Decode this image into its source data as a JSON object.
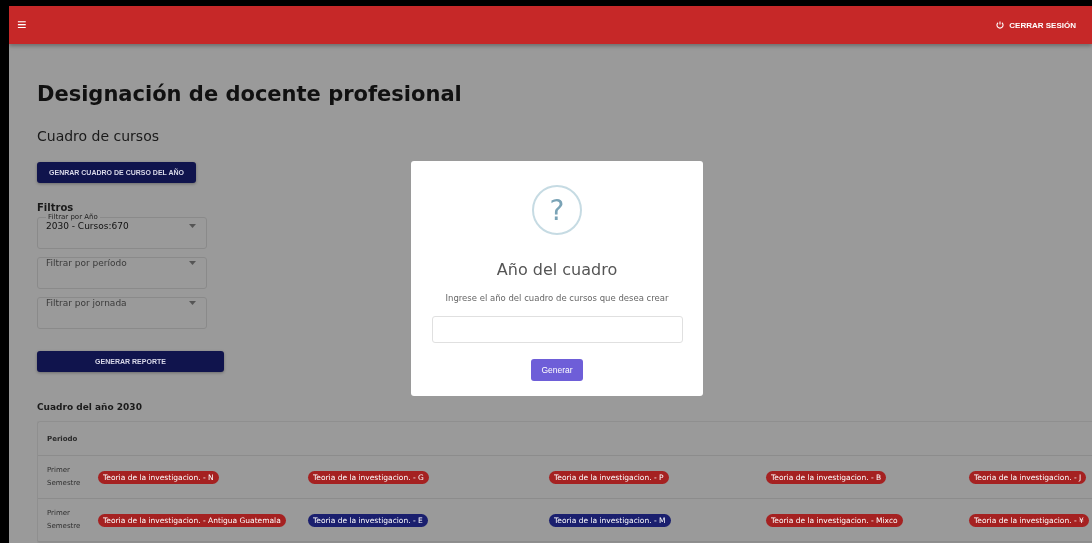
{
  "app_bar": {
    "menu_icon": "≡",
    "logout": "CERRAR SESIÓN"
  },
  "title": "Designación de docente profesional",
  "section": "Cuadro de cursos",
  "generate_button": "GENRAR CUADRO DE CURSO DEL AÑO",
  "filters": {
    "heading": "Filtros",
    "selects": [
      {
        "label": "Filtrar por Año",
        "value": "2030 - Cursos:670"
      },
      {
        "placeholder": "Filtrar por período"
      },
      {
        "placeholder": "Filtrar por jornada"
      }
    ],
    "report_button": "GENERAR REPORTE"
  },
  "table": {
    "title": "Cuadro del año 2030",
    "columns": [
      "Periodo"
    ],
    "rows": [
      {
        "period": "Primer Semestre",
        "courses": [
          {
            "label": "Teoria de la investigacion. - N",
            "color": "#a52121"
          },
          {
            "label": "Teoria de la investigacion. - G",
            "color": "#a52121"
          },
          {
            "label": "Teoria de la investigacion. - P",
            "color": "#a52121"
          },
          {
            "label": "Teoria de la investigacion. - B",
            "color": "#a52121"
          },
          {
            "label": "Teoria de la investigacion. - J",
            "color": "#a52121"
          }
        ]
      },
      {
        "period": "Primer Semestre",
        "courses": [
          {
            "label": "Teoria de la investigacion. - Antigua Guatemala",
            "color": "#a52121"
          },
          {
            "label": "Teoria de la investigacion. - E",
            "color": "#1a1f6e"
          },
          {
            "label": "Teoria de la investigacion. - M",
            "color": "#1a1f6e"
          },
          {
            "label": "Teoria de la investigacion. - Mixco",
            "color": "#a52121"
          },
          {
            "label": "Teoria de la investigacion. - ¥",
            "color": "#a52121"
          }
        ]
      }
    ]
  },
  "dialog": {
    "icon": "?",
    "title": "Año del cuadro",
    "text": "Ingrese el año del cuadro de cursos que desea crear",
    "button": "Generar"
  }
}
